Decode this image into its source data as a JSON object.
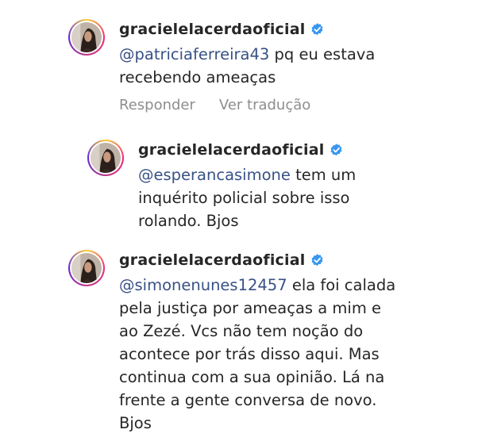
{
  "comments": [
    {
      "username": "gracielelacerdaoficial",
      "mention": "@patriciaferreira43",
      "text": " pq eu estava\nrecebendo ameaças",
      "actions": {
        "reply": "Responder",
        "translate": "Ver tradução"
      }
    },
    {
      "username": "gracielelacerdaoficial",
      "mention": "@esperancasimone",
      "text": " tem um\ninquérito policial sobre isso\nrolando. Bjos"
    },
    {
      "username": "gracielelacerdaoficial",
      "mention": "@simonenunes12457",
      "text": " ela foi calada\npela justiça por ameaças a mim e\nao Zezé. Vcs não tem noção do\nacontece por trás disso aqui. Mas\ncontinua com a sua opinião. Lá na\nfrente  a gente conversa de novo.\nBjos"
    }
  ],
  "colors": {
    "mention": "#385185",
    "verified": "#3897f0",
    "muted": "#8e8e8e"
  },
  "icons": {
    "verified": "verified-badge-icon",
    "avatar": "profile-avatar"
  }
}
